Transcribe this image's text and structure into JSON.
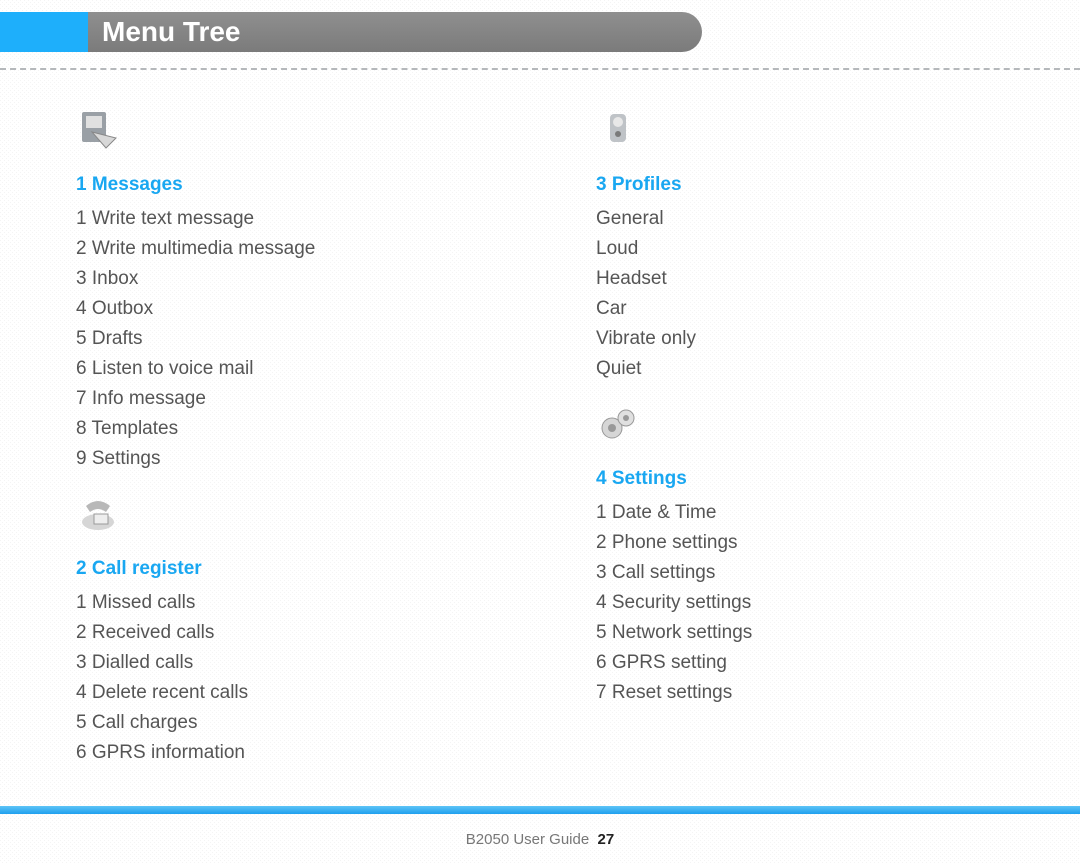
{
  "header": {
    "title": "Menu Tree"
  },
  "sections": [
    {
      "num": "1",
      "title": "Messages",
      "icon": "messages",
      "items": [
        "1 Write text message",
        "2 Write multimedia message",
        "3 Inbox",
        "4 Outbox",
        "5 Drafts",
        "6 Listen to voice mail",
        "7 Info message",
        "8 Templates",
        "9 Settings"
      ]
    },
    {
      "num": "2",
      "title": "Call register",
      "icon": "callregister",
      "items": [
        "1 Missed calls",
        "2 Received calls",
        "3 Dialled calls",
        "4 Delete recent calls",
        "5 Call charges",
        "6 GPRS information"
      ]
    },
    {
      "num": "3",
      "title": "Profiles",
      "icon": "profiles",
      "items": [
        "General",
        "Loud",
        "Headset",
        "Car",
        "Vibrate only",
        "Quiet"
      ]
    },
    {
      "num": "4",
      "title": "Settings",
      "icon": "settings",
      "items": [
        "1 Date & Time",
        "2 Phone settings",
        "3 Call settings",
        "4 Security settings",
        "5 Network settings",
        "6 GPRS setting",
        "7 Reset settings"
      ]
    }
  ],
  "footer": {
    "guide": "B2050 User Guide",
    "page": "27"
  }
}
